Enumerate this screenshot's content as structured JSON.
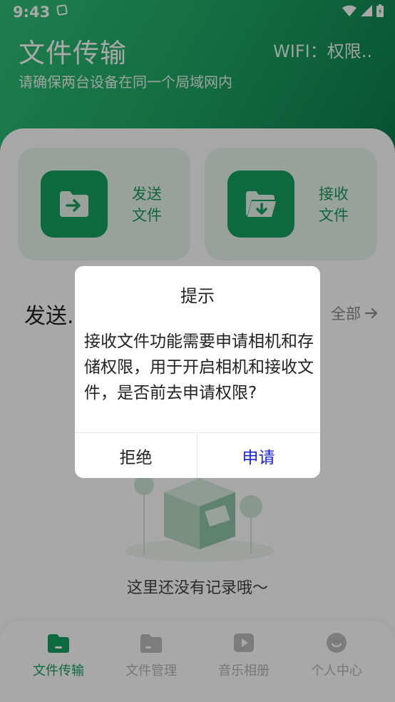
{
  "status": {
    "time": "9:43"
  },
  "header": {
    "title": "文件传输",
    "wifi": "WIFI：权限..",
    "subtitle": "请确保两台设备在同一个局域网内"
  },
  "actions": {
    "send_label": "发送文件",
    "receive_label": "接收文件"
  },
  "section": {
    "title": "发送.",
    "view_all": "全部"
  },
  "empty_state": {
    "text": "这里还没有记录哦～"
  },
  "bottom_nav": [
    {
      "label": "文件传输",
      "icon": "folder-icon",
      "active": true
    },
    {
      "label": "文件管理",
      "icon": "folder-manage-icon",
      "active": false
    },
    {
      "label": "音乐相册",
      "icon": "play-album-icon",
      "active": false
    },
    {
      "label": "个人中心",
      "icon": "profile-icon",
      "active": false
    }
  ],
  "dialog": {
    "title": "提示",
    "message": "接收文件功能需要申请相机和存储权限，用于开启相机和接收文件，是否前去申请权限?",
    "reject_label": "拒绝",
    "apply_label": "申请"
  },
  "colors": {
    "primary": "#15a05f",
    "link_blue": "#1a23d6",
    "card_bg": "#e8f5ee"
  }
}
